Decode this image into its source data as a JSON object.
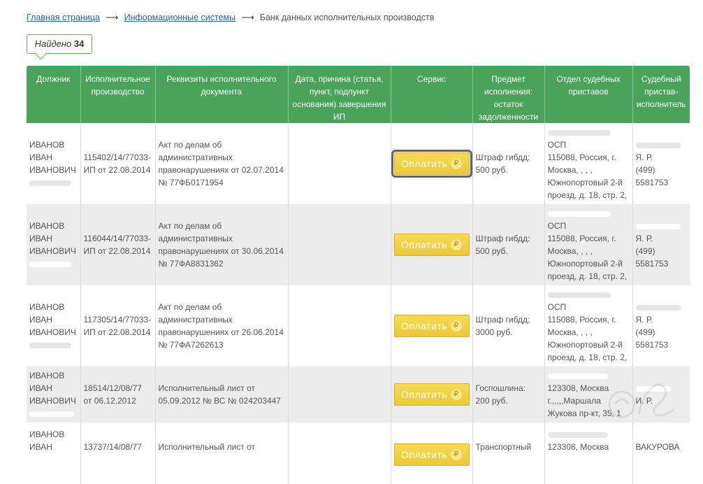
{
  "breadcrumb": {
    "home": "Главная страница",
    "info_systems": "Информационные системы",
    "separator": "⟶",
    "current": "Банк данных исполнительных производств"
  },
  "found": {
    "label": "Найдено",
    "count": "34"
  },
  "table": {
    "headers": [
      "Должник",
      "Исполнительное производство",
      "Реквизиты исполнительного документа",
      "Дата, причина (статья, пункт, подпункт основания) завершения ИП",
      "Сервис",
      "Предмет исполнения: остаток задолженности",
      "Отдел судебных приставов",
      "Судебный пристав-исполнитель"
    ],
    "pay_label": "Оплатить",
    "rub_symbol": "₽",
    "rows": [
      {
        "debtor": [
          "ИВАНОВ",
          "ИВАН",
          "ИВАНОВИЧ"
        ],
        "proceeding": [
          "115402/14/77033-",
          "ИП от 22.08.2014"
        ],
        "document": [
          "Акт по делам об",
          "административных",
          "правонарушениях от 02.07.2014",
          "№ 77ФБ0171954"
        ],
        "subject": [
          "Штраф гибдд:",
          "500 руб."
        ],
        "department": [
          "ОСП",
          "115088, Россия, г.",
          "Москва, , , ,",
          "Южнопортовый 2-й",
          "проезд, д. 18, стр. 2,"
        ],
        "bailiff": [
          "Я. Р.",
          "(499)",
          "5581753"
        ]
      },
      {
        "debtor": [
          "ИВАНОВ",
          "ИВАН",
          "ИВАНОВИЧ"
        ],
        "proceeding": [
          "116044/14/77033-",
          "ИП от 22.08.2014"
        ],
        "document": [
          "Акт по делам об",
          "административных",
          "правонарушениях от 30.06.2014",
          "№ 77ФА8831362"
        ],
        "subject": [
          "Штраф гибдд:",
          "500 руб."
        ],
        "department": [
          "ОСП",
          "115088, Россия, г.",
          "Москва, , , ,",
          "Южнопортовый 2-й",
          "проезд, д. 18, стр. 2,"
        ],
        "bailiff": [
          "Я. Р.",
          "(499)",
          "5581753"
        ]
      },
      {
        "debtor": [
          "ИВАНОВ",
          "ИВАН",
          "ИВАНОВИЧ"
        ],
        "proceeding": [
          "117305/14/77033-",
          "ИП от 22.08.2014"
        ],
        "document": [
          "Акт по делам об",
          "административных",
          "правонарушениях от 26.06.2014",
          "№ 77ФА7262613"
        ],
        "subject": [
          "Штраф гибдд:",
          "3000 руб."
        ],
        "department": [
          "ОСП",
          "115088, Россия, г.",
          "Москва, , , ,",
          "Южнопортовый 2-й",
          "проезд, д. 18, стр. 2,"
        ],
        "bailiff": [
          "Я. Р.",
          "(499)",
          "5581753"
        ]
      },
      {
        "debtor": [
          "ИВАНОВ",
          "ИВАН",
          "ИВАНОВИЧ"
        ],
        "proceeding": [
          "18514/12/08/77",
          "от 06.12.2012"
        ],
        "document": [
          "Исполнительный лист от",
          "05.09.2012 № ВС № 024203447"
        ],
        "subject": [
          "Госпошлина:",
          "200 руб."
        ],
        "department": [
          "123308, Москва",
          "г.,,,,,Маршала",
          "Жукова пр-кт, 35, 1"
        ],
        "bailiff": [
          "И. Р."
        ]
      },
      {
        "debtor": [
          "ИВАНОВ",
          "ИВАН"
        ],
        "proceeding": [
          "",
          "13737/14/08/77"
        ],
        "document": [
          "",
          "Исполнительный лист от"
        ],
        "subject": [
          "",
          "Транспортный"
        ],
        "department": [
          "",
          "123308, Москва"
        ],
        "bailiff": [
          "",
          "ВАКУРОВА"
        ]
      }
    ]
  },
  "colors": {
    "header_green": "#49a35b",
    "pay_button_yellow": "#ecc934",
    "link_blue": "#2a62a8",
    "row_alt_gray": "#ececec"
  }
}
